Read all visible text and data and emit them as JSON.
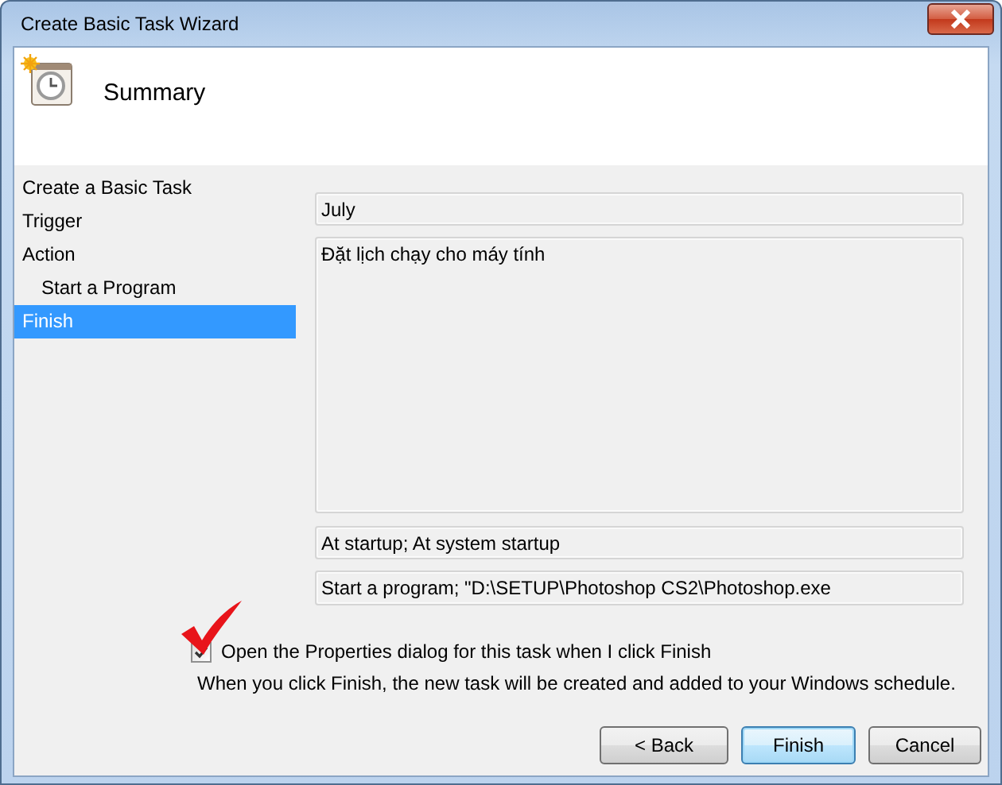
{
  "window": {
    "title": "Create Basic Task Wizard"
  },
  "header": {
    "title": "Summary"
  },
  "steps": [
    {
      "label": "Create a Basic Task",
      "selected": false
    },
    {
      "label": "Trigger",
      "selected": false
    },
    {
      "label": "Action",
      "selected": false,
      "children": [
        {
          "label": "Start a Program",
          "selected": false
        }
      ]
    },
    {
      "label": "Finish",
      "selected": true
    }
  ],
  "summary": {
    "name": "July",
    "description": "Đặt lịch chạy cho máy tính",
    "trigger": "At startup; At system startup",
    "action": "Start a program; \"D:\\SETUP\\Photoshop CS2\\Photoshop.exe"
  },
  "open_properties": {
    "label": "Open the Properties dialog for this task when I click Finish",
    "checked": true
  },
  "note": "When you click Finish, the new task will be created and added to your Windows schedule.",
  "buttons": [
    {
      "label": "< Back",
      "default": false
    },
    {
      "label": "Finish",
      "default": true
    },
    {
      "label": "Cancel",
      "default": false
    }
  ]
}
